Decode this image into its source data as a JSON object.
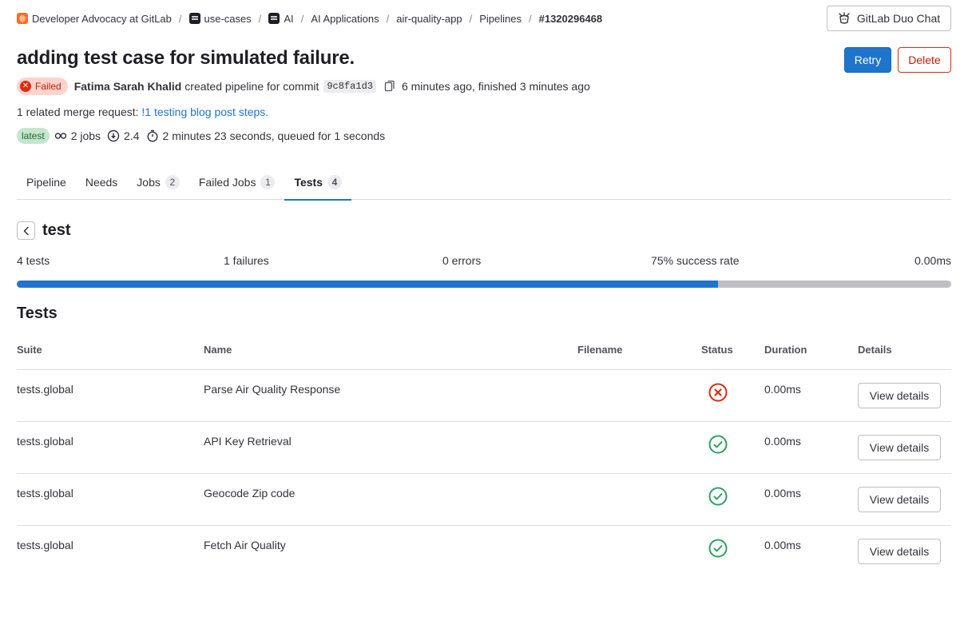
{
  "breadcrumb": [
    {
      "label": "Developer Advocacy at GitLab",
      "avatar": "org"
    },
    {
      "label": "use-cases",
      "avatar": "dark"
    },
    {
      "label": "AI",
      "avatar": "dark"
    },
    {
      "label": "AI Applications",
      "avatar": ""
    },
    {
      "label": "air-quality-app",
      "avatar": ""
    },
    {
      "label": "Pipelines",
      "avatar": ""
    },
    {
      "label": "#1320296468",
      "avatar": ""
    }
  ],
  "header": {
    "duo_chat_label": "GitLab Duo Chat",
    "title": "adding test case for simulated failure.",
    "retry_label": "Retry",
    "delete_label": "Delete"
  },
  "pipeline": {
    "status": "Failed",
    "author": "Fatima Sarah Khalid",
    "created_text": "created pipeline for commit",
    "commit_sha": "9c8fa1d3",
    "time_text": "6 minutes ago, finished 3 minutes ago",
    "mr_prefix": "1 related merge request:",
    "mr_link": "!1 testing blog post steps.",
    "latest_label": "latest",
    "jobs_text": "2 jobs",
    "version_text": "2.4",
    "duration_text": "2 minutes 23 seconds, queued for 1 seconds"
  },
  "tabs": [
    {
      "label": "Pipeline",
      "count": null,
      "active": false
    },
    {
      "label": "Needs",
      "count": null,
      "active": false
    },
    {
      "label": "Jobs",
      "count": "2",
      "active": false
    },
    {
      "label": "Failed Jobs",
      "count": "1",
      "active": false
    },
    {
      "label": "Tests",
      "count": "4",
      "active": true
    }
  ],
  "suite": {
    "name": "test",
    "tests_text": "4 tests",
    "failures_text": "1 failures",
    "errors_text": "0 errors",
    "success_text": "75% success rate",
    "duration_text": "0.00ms",
    "success_rate": 75
  },
  "tests_table": {
    "heading": "Tests",
    "columns": [
      "Suite",
      "Name",
      "Filename",
      "Status",
      "Duration",
      "Details"
    ],
    "rows": [
      {
        "suite": "tests.global",
        "name": "Parse Air Quality Response",
        "filename": "",
        "status": "failed",
        "duration": "0.00ms",
        "details": "View details"
      },
      {
        "suite": "tests.global",
        "name": "API Key Retrieval",
        "filename": "",
        "status": "success",
        "duration": "0.00ms",
        "details": "View details"
      },
      {
        "suite": "tests.global",
        "name": "Geocode Zip code",
        "filename": "",
        "status": "success",
        "duration": "0.00ms",
        "details": "View details"
      },
      {
        "suite": "tests.global",
        "name": "Fetch Air Quality",
        "filename": "",
        "status": "success",
        "duration": "0.00ms",
        "details": "View details"
      }
    ]
  },
  "colors": {
    "accent": "#1f75cb",
    "danger": "#dd2b0e",
    "success": "#2da160",
    "progress_track": "#bfbfc3"
  }
}
